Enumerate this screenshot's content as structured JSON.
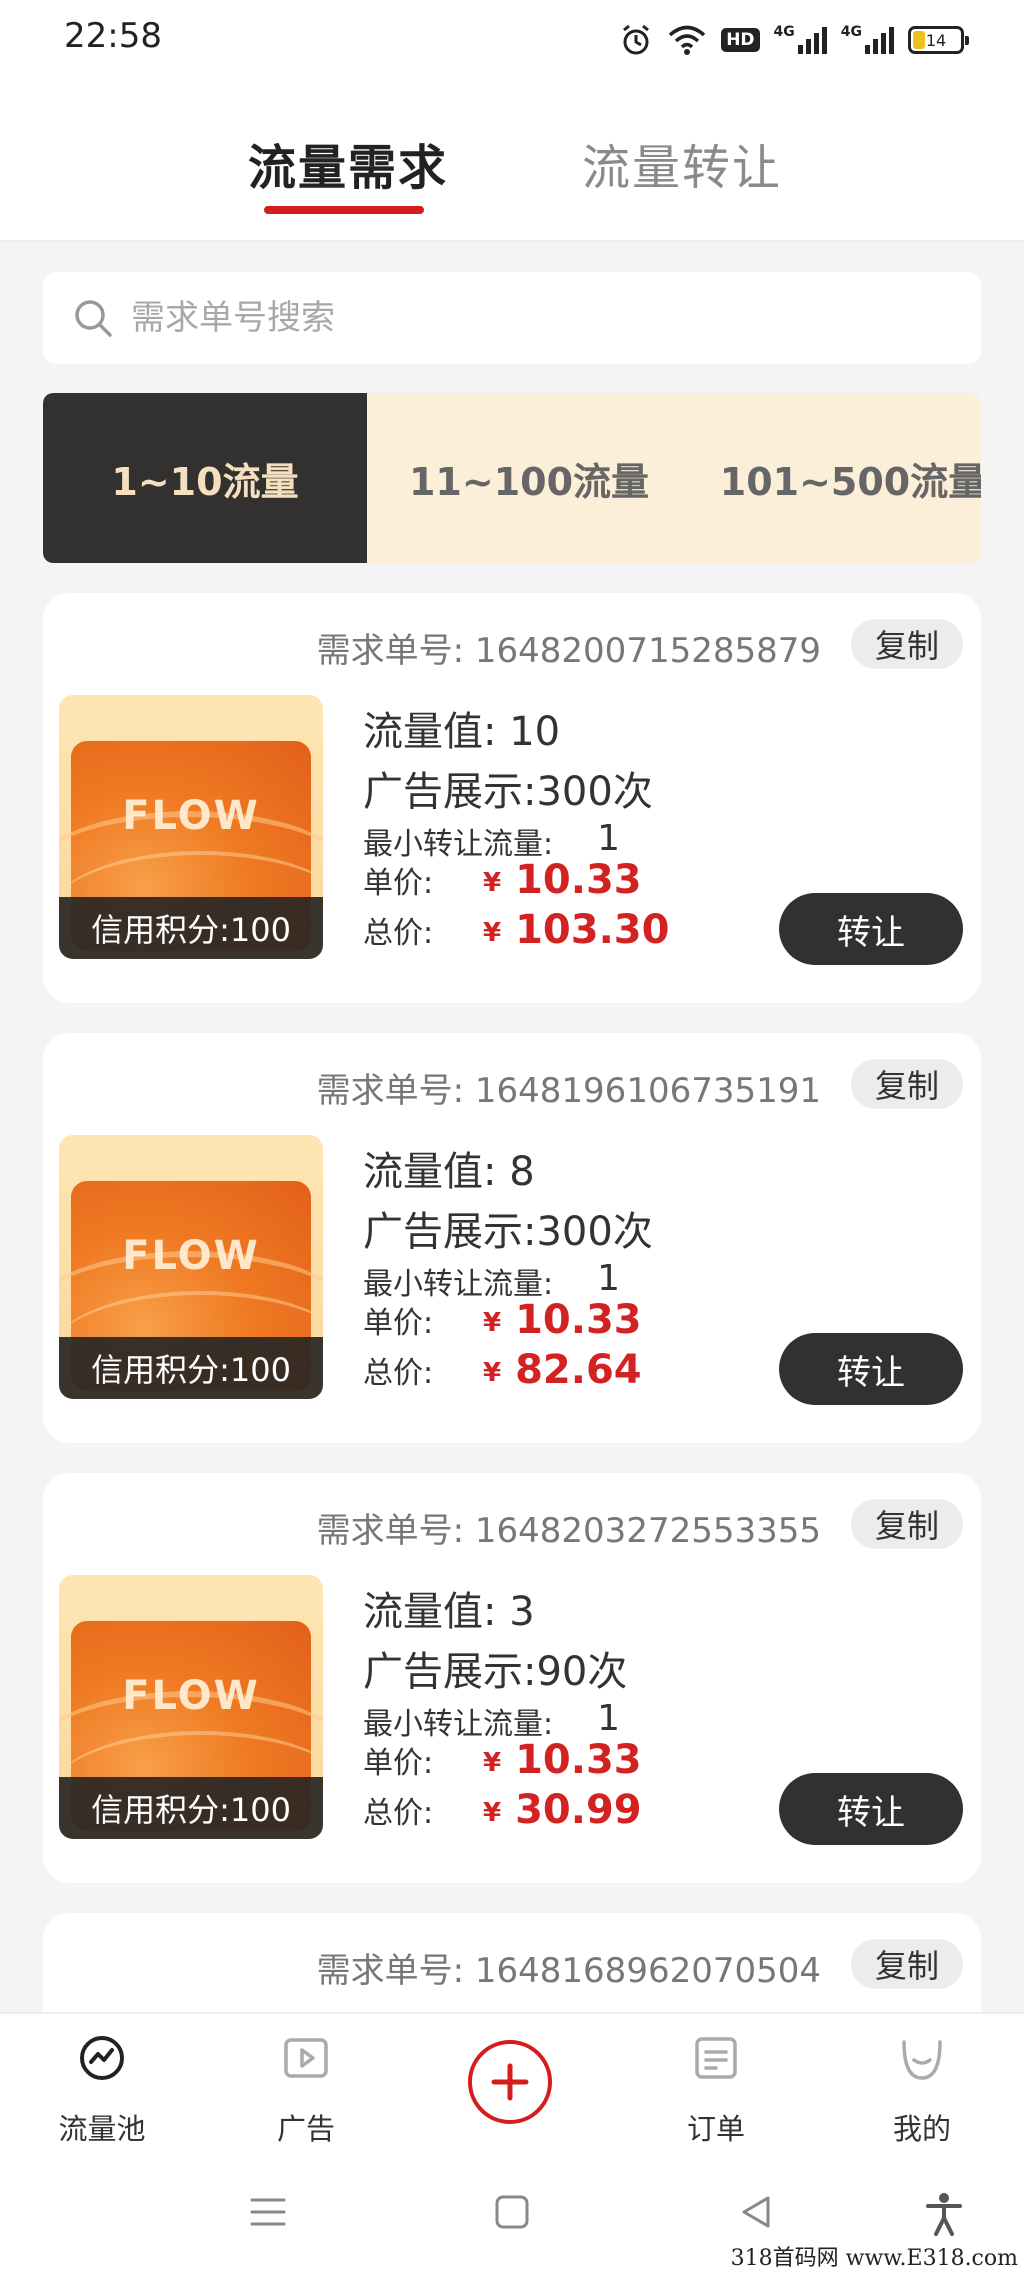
{
  "status_bar": {
    "time": "22:58",
    "network_1": "4G",
    "network_2": "4G",
    "hd_label": "HD",
    "battery": "14"
  },
  "top_tabs": [
    {
      "label": "流量需求",
      "active": true
    },
    {
      "label": "流量转让",
      "active": false
    }
  ],
  "search": {
    "placeholder": "需求单号搜索",
    "value": ""
  },
  "filter_tabs": [
    {
      "label": "1~10流量",
      "active": true
    },
    {
      "label": "11~100流量",
      "active": false
    },
    {
      "label": "101~500流量",
      "active": false
    }
  ],
  "labels": {
    "order_no": "需求单号:",
    "copy": "复制",
    "flow_value": "流量值:",
    "ad_display": "广告展示:",
    "min_transfer": "最小转让流量:",
    "unit_price": "单价:",
    "total_price": "总价:",
    "currency": "¥",
    "transfer": "转让",
    "image_text": "FLOW"
  },
  "cards": [
    {
      "order_no": "1648200715285879",
      "flow_value": "10",
      "ad_display": "300次",
      "min_transfer": "1",
      "unit_price": "10.33",
      "total_price": "103.30",
      "credit": "信用积分:100"
    },
    {
      "order_no": "1648196106735191",
      "flow_value": "8",
      "ad_display": "300次",
      "min_transfer": "1",
      "unit_price": "10.33",
      "total_price": "82.64",
      "credit": "信用积分:100"
    },
    {
      "order_no": "1648203272553355",
      "flow_value": "3",
      "ad_display": "90次",
      "min_transfer": "1",
      "unit_price": "10.33",
      "total_price": "30.99",
      "credit": "信用积分:100"
    },
    {
      "order_no": "1648168962070504"
    }
  ],
  "bottom_nav": [
    {
      "label": "流量池",
      "icon": "flow-pool-icon",
      "active": true
    },
    {
      "label": "广告",
      "icon": "ad-play-icon",
      "active": false
    },
    {
      "label": "",
      "icon": "add-circle-icon",
      "active": false
    },
    {
      "label": "订单",
      "icon": "order-list-icon",
      "active": false
    },
    {
      "label": "我的",
      "icon": "profile-smile-icon",
      "active": false
    }
  ],
  "watermark": "318首码网 www.E318.com",
  "colors": {
    "accent_red": "#d41e1e",
    "dark": "#333130",
    "price_red": "#d32222",
    "filter_bg": "#fcefd9",
    "filter_active_text": "#f4dfbf"
  }
}
